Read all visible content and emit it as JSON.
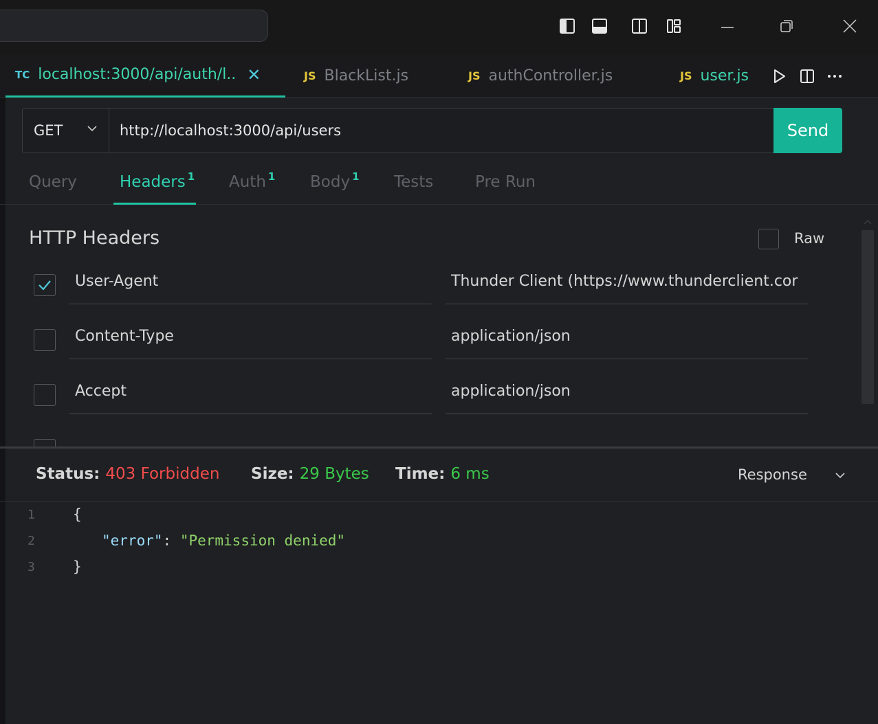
{
  "window": {
    "icons": [
      "toggle-primary-sidebar-icon",
      "toggle-panel-icon",
      "toggle-secondary-sidebar-icon",
      "customize-layout-icon",
      "minimize-icon",
      "restore-icon",
      "close-icon"
    ]
  },
  "tabs": [
    {
      "badge": "TC",
      "label": "localhost:3000/api/auth/l..",
      "active": true,
      "close": "✕"
    },
    {
      "badge": "JS",
      "label": "BlackList.js",
      "active": false
    },
    {
      "badge": "JS",
      "label": "authController.js",
      "active": false
    },
    {
      "badge": "JS",
      "label": "user.js",
      "active": false
    }
  ],
  "request": {
    "method": "GET",
    "url": "http://localhost:3000/api/users",
    "send_label": "Send"
  },
  "subtabs": [
    {
      "label": "Query",
      "count": ""
    },
    {
      "label": "Headers",
      "count": "1"
    },
    {
      "label": "Auth",
      "count": "1"
    },
    {
      "label": "Body",
      "count": "1"
    },
    {
      "label": "Tests",
      "count": ""
    },
    {
      "label": "Pre Run",
      "count": ""
    }
  ],
  "headers_panel": {
    "title": "HTTP Headers",
    "raw_label": "Raw",
    "rows": [
      {
        "key": "User-Agent",
        "value": "Thunder Client (https://www.thunderclient.cor",
        "checked": true
      },
      {
        "key": "Content-Type",
        "value": "application/json",
        "checked": false
      },
      {
        "key": "Accept",
        "value": "application/json",
        "checked": false
      }
    ]
  },
  "response": {
    "status_label": "Status:",
    "status_value": "403 Forbidden",
    "size_label": "Size:",
    "size_value": "29 Bytes",
    "time_label": "Time:",
    "time_value": "6 ms",
    "view_label": "Response",
    "lines": [
      {
        "num": "1",
        "text": "{"
      },
      {
        "num": "2",
        "key": "\"error\"",
        "sep": ": ",
        "value": "\"Permission denied\""
      },
      {
        "num": "3",
        "text": "}"
      }
    ]
  },
  "colors": {
    "accent": "#21c2a3",
    "error": "#f14c4c",
    "success": "#3ac94a",
    "js_badge": "#e5c83a"
  }
}
